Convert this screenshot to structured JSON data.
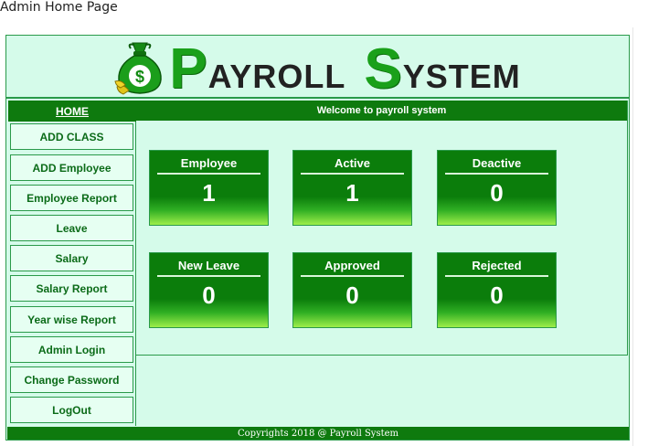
{
  "page": {
    "heading": "Admin Home Page"
  },
  "banner": {
    "logo_icon": "money-bag-icon",
    "title_first_cap": "P",
    "title_first_rest": "AYROLL",
    "title_second_cap": "S",
    "title_second_rest": "YSTEM"
  },
  "sidebar": {
    "home_label": "HOME",
    "items": [
      {
        "label": "ADD CLASS"
      },
      {
        "label": "ADD Employee"
      },
      {
        "label": "Employee Report"
      },
      {
        "label": "Leave"
      },
      {
        "label": "Salary"
      },
      {
        "label": "Salary Report"
      },
      {
        "label": "Year wise Report"
      },
      {
        "label": "Admin Login"
      },
      {
        "label": "Change Password"
      },
      {
        "label": "LogOut"
      }
    ]
  },
  "main": {
    "welcome": "Welcome to payroll system",
    "stats": [
      {
        "label": "Employee",
        "value": "1"
      },
      {
        "label": "Active",
        "value": "1"
      },
      {
        "label": "Deactive",
        "value": "0"
      },
      {
        "label": "New Leave",
        "value": "0"
      },
      {
        "label": "Approved",
        "value": "0"
      },
      {
        "label": "Rejected",
        "value": "0"
      }
    ]
  },
  "footer": {
    "text": "Copyrights 2018 @ Payroll System"
  },
  "colors": {
    "brand_green": "#0e7a0e",
    "logo_green": "#1aa01a",
    "background_mint": "#d5fbea",
    "border_green": "#2a9a4a"
  }
}
